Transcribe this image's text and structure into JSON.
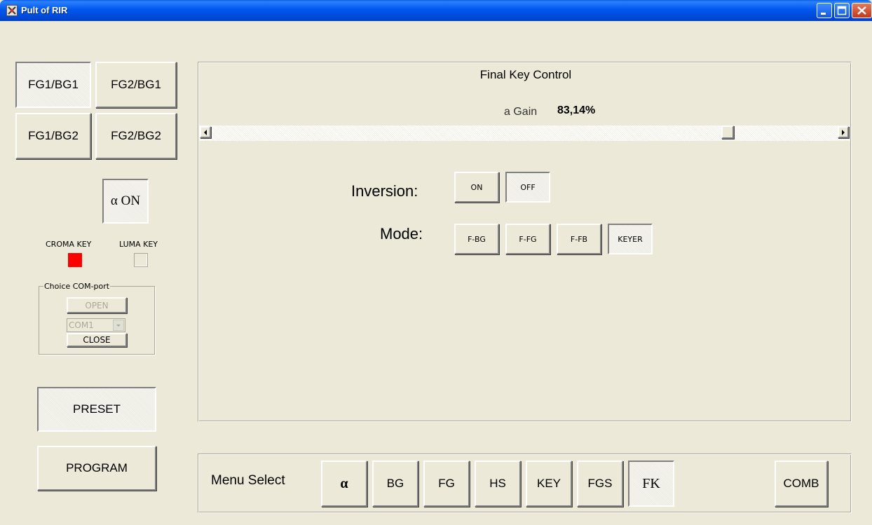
{
  "window": {
    "title": "Pult of RIR"
  },
  "bus_buttons": {
    "fg1bg1": "FG1/BG1",
    "fg2bg1": "FG2/BG1",
    "fg1bg2": "FG1/BG2",
    "fg2bg2": "FG2/BG2"
  },
  "alpha_on": "α ON",
  "indicators": {
    "chroma_label": "CROMA KEY",
    "luma_label": "LUMA KEY",
    "chroma_color": "#ff0000",
    "luma_color": "#ece9d8"
  },
  "com_port": {
    "group_title": "Choice COM-port",
    "open_label": "OPEN",
    "port_value": "COM1",
    "close_label": "CLOSE"
  },
  "preset_label": "PRESET",
  "program_label": "PROGRAM",
  "final_key": {
    "title": "Final Key Control",
    "gain_label": "a Gain",
    "gain_value": "83,14%",
    "gain_fraction": 0.8314
  },
  "inversion": {
    "label": "Inversion:",
    "on": "ON",
    "off": "OFF"
  },
  "mode": {
    "label": "Mode:",
    "options": [
      "F-BG",
      "F-FG",
      "F-FB",
      "KEYER"
    ]
  },
  "menu": {
    "label": "Menu Select",
    "items": [
      "α",
      "BG",
      "FG",
      "HS",
      "KEY",
      "FGS",
      "FK",
      "COMB"
    ]
  }
}
